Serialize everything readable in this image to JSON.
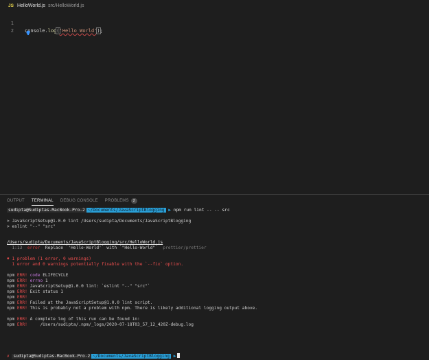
{
  "editor": {
    "tab": {
      "icon": "JS",
      "filename": "HelloWorld.js",
      "path": "src/HelloWorld.js"
    },
    "lines": [
      {
        "number": "1",
        "ident": "console",
        "dot": ".",
        "fn": "log",
        "open": "(",
        "string": "'Hello World'",
        "close": ")",
        "semi": ";"
      },
      {
        "number": "2"
      }
    ],
    "lightbulb_icon": "lightbulb-icon"
  },
  "panel": {
    "tabs": [
      {
        "label": "OUTPUT",
        "active": false
      },
      {
        "label": "TERMINAL",
        "active": true
      },
      {
        "label": "DEBUG CONSOLE",
        "active": false
      },
      {
        "label": "PROBLEMS",
        "active": false,
        "badge": "2"
      }
    ]
  },
  "terminal": {
    "prompt1": {
      "user": "sudipta@Sudiptas-MacBook-Pro-2",
      "dir": "~/Documents/JavaScriptBlogging",
      "command": "npm run lint -- -- src"
    },
    "script_line1": "> JavaScriptSetup@1.0.0 lint /Users/sudipta/Documents/JavaScriptBlogging",
    "script_line2": "> eslint \"--\" \"src\"",
    "error_file": "/Users/sudipta/Documents/JavaScriptBlogging/src/HelloWorld.js",
    "error_line": {
      "location": "1:13",
      "severity": "error",
      "message": "Replace `'Hello·World'` with `\"Hello·World\"`",
      "rule": "prettier/prettier"
    },
    "summary1": "✖ 1 problem (1 error, 0 warnings)",
    "summary2": "  1 error and 0 warnings potentially fixable with the `--fix` option.",
    "npm_errors": [
      {
        "prefix": "npm",
        "err": "ERR!",
        "key": "code",
        "text": " ELIFECYCLE"
      },
      {
        "prefix": "npm",
        "err": "ERR!",
        "key": "errno",
        "text": " 1"
      },
      {
        "prefix": "npm",
        "err": "ERR!",
        "key": "",
        "text": "JavaScriptSetup@1.0.0 lint: `eslint \"--\" \"src\"`"
      },
      {
        "prefix": "npm",
        "err": "ERR!",
        "key": "",
        "text": "Exit status 1"
      },
      {
        "prefix": "npm",
        "err": "ERR!",
        "key": "",
        "text": ""
      },
      {
        "prefix": "npm",
        "err": "ERR!",
        "key": "",
        "text": "Failed at the JavaScriptSetup@1.0.0 lint script."
      },
      {
        "prefix": "npm",
        "err": "ERR!",
        "key": "",
        "text": "This is probably not a problem with npm. There is likely additional logging output above."
      }
    ],
    "npm_log": [
      {
        "prefix": "npm",
        "err": "ERR!",
        "text": "A complete log of this run can be found in:"
      },
      {
        "prefix": "npm",
        "err": "ERR!",
        "text": "    /Users/sudipta/.npm/_logs/2020-07-18T03_57_12_420Z-debug.log"
      }
    ],
    "prompt2": {
      "status": "✗",
      "user": "sudipta@Sudiptas-MacBook-Pro-2",
      "dir": "~/Documents/JavaScriptBlogging"
    }
  }
}
